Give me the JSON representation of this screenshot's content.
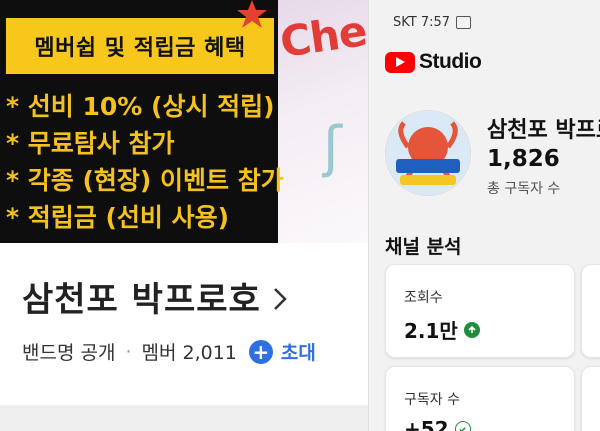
{
  "band": {
    "promo_banner_title": "멤버쉽 및 적립금 혜택",
    "promo_side_text": "Che",
    "benefits": [
      "* 선비 10% (상시 적립)",
      "* 무료탐사 참가",
      "* 각종 (현장) 이벤트 참가",
      "* 적립금 (선비 사용)"
    ],
    "name": "삼천포 박프로호",
    "visibility": "밴드명 공개",
    "members": "멤버 2,011",
    "invite_label": "초대"
  },
  "studio": {
    "status_time": "SKT 7:57",
    "app_name": "Studio",
    "channel_name": "삼천포 박프로호",
    "subscriber_count": "1,826",
    "subscriber_label": "총 구독자 수",
    "analytics_title": "채널 분석",
    "cards": [
      {
        "label": "조회수",
        "value": "2.1만",
        "trend_icon": "arrow-up-circle-icon"
      },
      {
        "label": "구독자 수",
        "value": "+52",
        "trend_icon": "check-circle-icon"
      }
    ]
  },
  "colors": {
    "promo_yellow": "#f7c71c",
    "benefit_text": "#f5c21d",
    "youtube_red": "#ff0000",
    "invite_blue": "#2f6fe4",
    "trend_green": "#1e8e3e"
  }
}
